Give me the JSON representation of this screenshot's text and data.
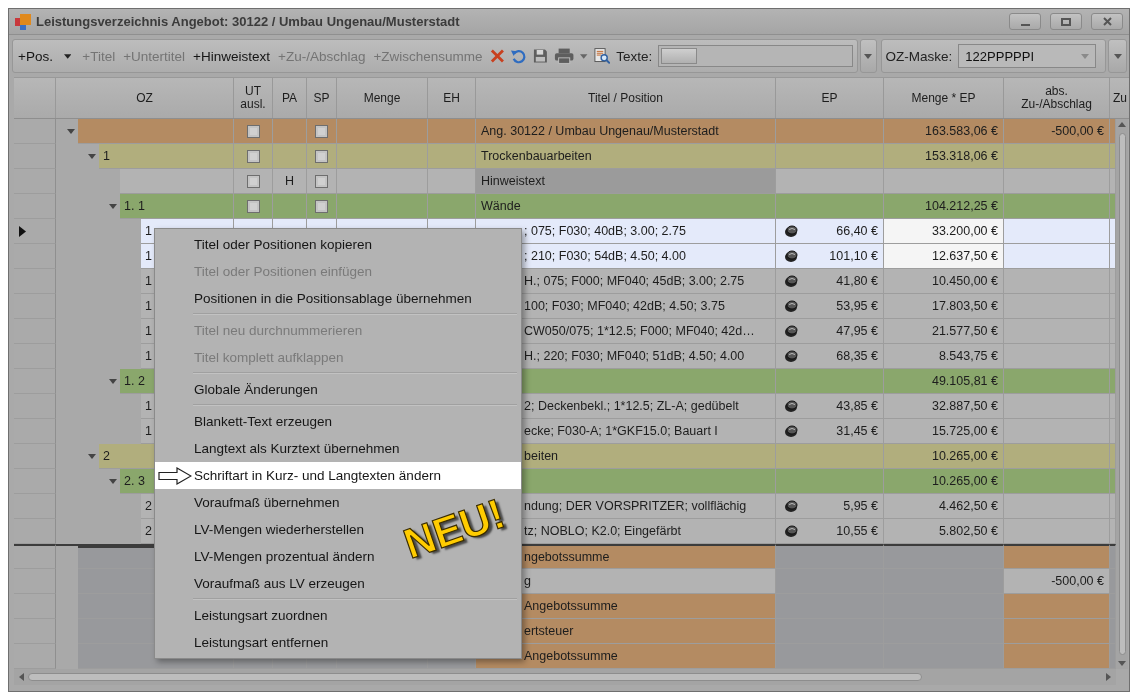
{
  "window": {
    "title": "Leistungsverzeichnis Angebot: 30122 / Umbau Ungenau/Musterstadt"
  },
  "toolbar": {
    "buttons": [
      {
        "label": "+Pos.",
        "disabled": false,
        "has_menu": true
      },
      {
        "label": "+Titel",
        "disabled": true,
        "has_menu": false
      },
      {
        "label": "+Untertitel",
        "disabled": true,
        "has_menu": false
      },
      {
        "label": "+Hinweistext",
        "disabled": false,
        "has_menu": false
      },
      {
        "label": "+Zu-/Abschlag",
        "disabled": true,
        "has_menu": false
      },
      {
        "label": "+Zwischensumme",
        "disabled": true,
        "has_menu": false
      }
    ],
    "texts_label": "Texte:",
    "texts_slider": {
      "level": 0
    },
    "mask_label": "OZ-Maske:",
    "mask_value": "122PPPPPI"
  },
  "grid": {
    "columns": [
      "OZ",
      "UT\nausl.",
      "PA",
      "SP",
      "Menge",
      "EH",
      "Titel / Position",
      "EP",
      "Menge * EP",
      "abs.\nZu-/Abschlag",
      "Zu"
    ],
    "rows": [
      {
        "kind": "offer",
        "title": "Ang. 30122 / Umbau Ungenau/Musterstadt",
        "total": "163.583,06 €",
        "abs": "-500,00 €",
        "ut_checked": false,
        "sp_checked": false,
        "expanded": true,
        "selected": false,
        "current": false,
        "children": [
          {
            "kind": "title",
            "oz": "1",
            "title": "Trockenbauarbeiten",
            "total": "153.318,06 €",
            "ut_checked": false,
            "sp_checked": false,
            "expanded": true,
            "selected": false,
            "current": false,
            "children": [
              {
                "kind": "note",
                "pa": "H",
                "title": "Hinweistext",
                "ut_checked": false,
                "sp_checked": false,
                "selected": false,
                "current": false
              },
              {
                "kind": "subtitle",
                "oz": "1. 1",
                "title": "Wände",
                "total": "104.212,25 €",
                "ut_checked": false,
                "sp_checked": false,
                "expanded": true,
                "selected": false,
                "current": false,
                "children": [
                  {
                    "kind": "position",
                    "oz": "1",
                    "title": "; 075; F030; 40dB; 3.00; 2.75",
                    "ep": "66,40 €",
                    "total": "33.200,00 €",
                    "selected": true,
                    "current": true
                  },
                  {
                    "kind": "position",
                    "oz": "1",
                    "title": "; 210; F030; 54dB; 4.50; 4.00",
                    "ep": "101,10 €",
                    "total": "12.637,50 €",
                    "selected": true,
                    "current": false
                  },
                  {
                    "kind": "position",
                    "oz": "1",
                    "title": "H.; 075; F000; MF040; 45dB; 3.00; 2.75",
                    "ep": "41,80 €",
                    "total": "10.450,00 €",
                    "selected": false,
                    "current": false
                  },
                  {
                    "kind": "position",
                    "oz": "1",
                    "title": "100; F030; MF040; 42dB; 4.50; 3.75",
                    "ep": "53,95 €",
                    "total": "17.803,50 €",
                    "selected": false,
                    "current": false
                  },
                  {
                    "kind": "position",
                    "oz": "1",
                    "title": "CW050/075; 1*12.5; F000; MF040; 42d…",
                    "ep": "47,95 €",
                    "total": "21.577,50 €",
                    "selected": false,
                    "current": false
                  },
                  {
                    "kind": "position",
                    "oz": "1",
                    "title": "H.; 220; F030; MF040; 51dB; 4.50; 4.00",
                    "ep": "68,35 €",
                    "total": "8.543,75 €",
                    "selected": false,
                    "current": false
                  }
                ]
              },
              {
                "kind": "subtitle",
                "oz": "1. 2",
                "total": "49.105,81 €",
                "expanded": true,
                "selected": false,
                "current": false,
                "children": [
                  {
                    "kind": "position",
                    "oz": "1",
                    "title": "2; Deckenbekl.; 1*12.5; ZL-A; gedübelt",
                    "ep": "43,85 €",
                    "total": "32.887,50 €",
                    "selected": false,
                    "current": false
                  },
                  {
                    "kind": "position",
                    "oz": "1",
                    "title": "ecke;  F030-A; 1*GKF15.0; Bauart I",
                    "ep": "31,45 €",
                    "total": "15.725,00 €",
                    "selected": false,
                    "current": false
                  }
                ]
              }
            ]
          },
          {
            "kind": "title",
            "oz": "2",
            "title": "beiten",
            "total": "10.265,00 €",
            "expanded": true,
            "selected": false,
            "current": false,
            "children": [
              {
                "kind": "subtitle",
                "oz": "2. 3",
                "total": "10.265,00 €",
                "expanded": true,
                "selected": false,
                "current": false,
                "children": [
                  {
                    "kind": "position",
                    "oz": "2",
                    "title": "ndung; DER VORSPRITZER; vollflächig",
                    "ep": "5,95 €",
                    "total": "4.462,50 €",
                    "selected": false,
                    "current": false
                  },
                  {
                    "kind": "position",
                    "oz": "2",
                    "title": "tz; NOBLO; K2.0; Eingefärbt",
                    "ep": "10,55 €",
                    "total": "5.802,50 €",
                    "selected": false,
                    "current": false
                  }
                ]
              }
            ]
          }
        ]
      }
    ],
    "footer_rows": [
      {
        "kind": "sum",
        "title": "ngebotssumme"
      },
      {
        "kind": "adjustment",
        "title": "g",
        "abs": "-500,00 €"
      },
      {
        "kind": "sum",
        "title": "Angebotssumme"
      },
      {
        "kind": "sum",
        "title": "ertsteuer"
      },
      {
        "kind": "sum",
        "title": "Angebotssumme"
      }
    ]
  },
  "menu": {
    "items": [
      {
        "kind": "item",
        "label": "Titel oder Positionen kopieren",
        "disabled": false,
        "selected": false
      },
      {
        "kind": "item",
        "label": "Titel oder Positionen einfügen",
        "disabled": true,
        "selected": false
      },
      {
        "kind": "item",
        "label": "Positionen in die Positionsablage übernehmen",
        "disabled": false,
        "selected": false
      },
      {
        "kind": "separator"
      },
      {
        "kind": "item",
        "label": "Titel neu durchnummerieren",
        "disabled": true,
        "selected": false
      },
      {
        "kind": "item",
        "label": "Titel komplett aufklappen",
        "disabled": true,
        "selected": false
      },
      {
        "kind": "separator"
      },
      {
        "kind": "item",
        "label": "Globale Änderungen",
        "disabled": false,
        "selected": false
      },
      {
        "kind": "separator"
      },
      {
        "kind": "item",
        "label": "Blankett-Text erzeugen",
        "disabled": false,
        "selected": false
      },
      {
        "kind": "item",
        "label": "Langtext als Kurztext übernehmen",
        "disabled": false,
        "selected": false
      },
      {
        "kind": "item",
        "label": "Schriftart in Kurz- und Langtexten ändern",
        "disabled": false,
        "selected": true
      },
      {
        "kind": "item",
        "label": "Voraufmaß übernehmen",
        "disabled": false,
        "selected": false
      },
      {
        "kind": "item",
        "label": "LV-Mengen wiederherstellen",
        "disabled": false,
        "selected": false
      },
      {
        "kind": "item",
        "label": "LV-Mengen prozentual ändern",
        "disabled": false,
        "selected": false
      },
      {
        "kind": "item",
        "label": "Voraufmaß aus LV erzeugen",
        "disabled": false,
        "selected": false
      },
      {
        "kind": "separator"
      },
      {
        "kind": "item",
        "label": "Leistungsart zuordnen",
        "disabled": false,
        "selected": false
      },
      {
        "kind": "item",
        "label": "Leistungsart entfernen",
        "disabled": false,
        "selected": false
      }
    ]
  },
  "annotation": "NEU!"
}
